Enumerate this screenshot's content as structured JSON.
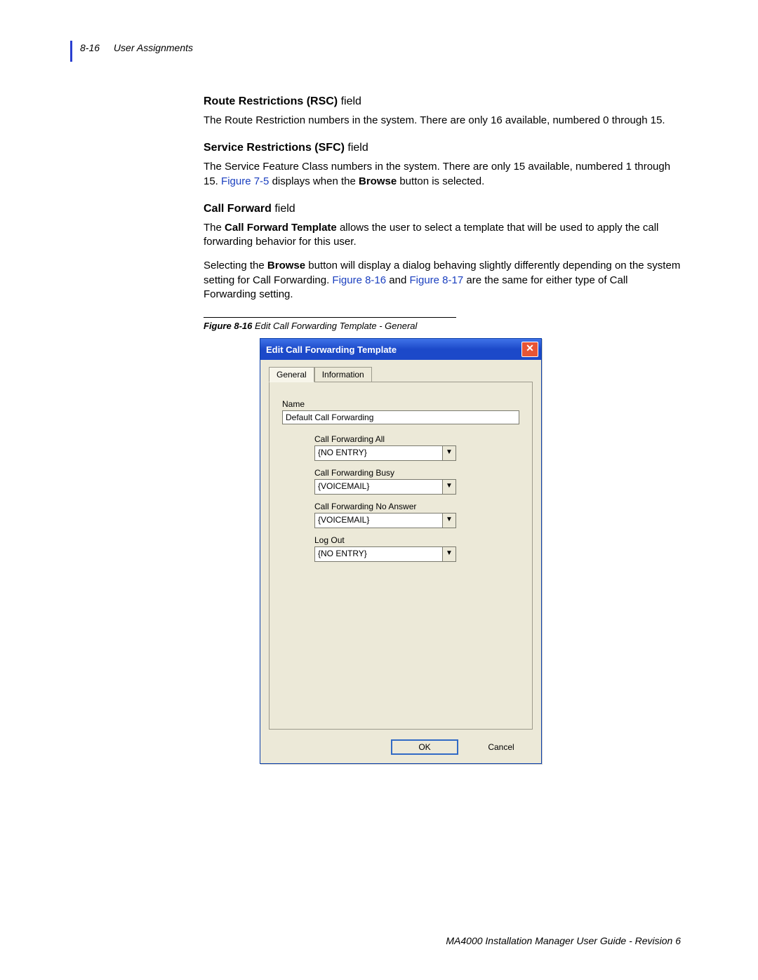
{
  "header": {
    "page_number": "8-16",
    "section": "User Assignments"
  },
  "sections": {
    "rsc": {
      "title_bold": "Route Restrictions (RSC)",
      "title_thin": " field",
      "body": "The Route Restriction numbers in the system. There are only 16 available, numbered 0 through 15."
    },
    "sfc": {
      "title_bold": "Service Restrictions (SFC)",
      "title_thin": " field",
      "body_pre": "The Service Feature Class numbers in the system. There are only 15 available, numbered 1 through 15. ",
      "link1": "Figure 7-5",
      "body_post1": " displays when the ",
      "bold1": "Browse",
      "body_post2": " button is selected."
    },
    "cf": {
      "title_bold": "Call Forward",
      "title_thin": " field",
      "p1_pre": "The ",
      "p1_bold": "Call Forward Template",
      "p1_post": " allows the user to select a template that will be used to apply the call forwarding behavior for this user.",
      "p2_pre": "Selecting the ",
      "p2_bold": "Browse",
      "p2_mid": " button will display a dialog behaving slightly differently depending on the system setting for Call Forwarding. ",
      "link_a": "Figure 8-16",
      "p2_and": " and ",
      "link_b": "Figure 8-17",
      "p2_post": " are the same for either type of Call Forwarding setting."
    }
  },
  "figure": {
    "number": "Figure 8-16",
    "caption": "  Edit Call Forwarding Template - General"
  },
  "dialog": {
    "title": "Edit Call Forwarding Template",
    "tabs": {
      "general": "General",
      "information": "Information"
    },
    "name_label": "Name",
    "name_value": "Default Call Forwarding",
    "fields": [
      {
        "label": "Call Forwarding All",
        "value": "{NO ENTRY}"
      },
      {
        "label": "Call Forwarding Busy",
        "value": "{VOICEMAIL}"
      },
      {
        "label": "Call Forwarding No Answer",
        "value": "{VOICEMAIL}"
      },
      {
        "label": "Log Out",
        "value": "{NO ENTRY}"
      }
    ],
    "buttons": {
      "ok": "OK",
      "cancel": "Cancel"
    }
  },
  "footer": "MA4000 Installation Manager User Guide - Revision 6"
}
